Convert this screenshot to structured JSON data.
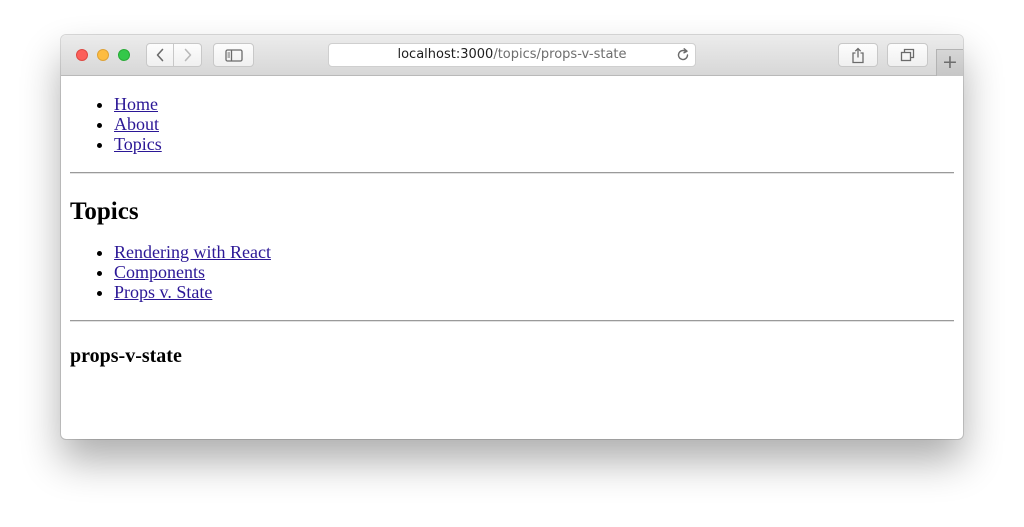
{
  "browser": {
    "address": {
      "host": "localhost:3000",
      "path": "/topics/props-v-state"
    },
    "new_tab_label": "+"
  },
  "nav": {
    "items": [
      {
        "label": "Home"
      },
      {
        "label": "About"
      },
      {
        "label": "Topics"
      }
    ]
  },
  "topics": {
    "heading": "Topics",
    "items": [
      {
        "label": "Rendering with React"
      },
      {
        "label": "Components"
      },
      {
        "label": "Props v. State"
      }
    ],
    "current": "props-v-state"
  },
  "colors": {
    "link": "#2b1796",
    "close": "#fc605b",
    "minimize": "#fdbc40",
    "maximize": "#34c84a"
  }
}
